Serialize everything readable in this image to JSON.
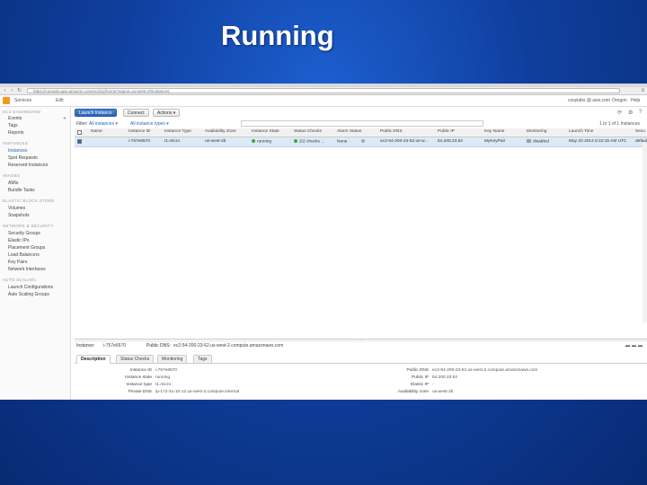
{
  "slide": {
    "title": "Running"
  },
  "browser": {
    "back_icon": "back-arrow-icon",
    "forward_icon": "forward-arrow-icon",
    "reload_icon": "reload-icon",
    "url": "https://console.aws.amazon.com/ec2/v2/home?region=us-west-2#Instances:",
    "menu_icon": "menu-icon"
  },
  "aws_nav": {
    "services": "Services",
    "edit": "Edit",
    "account": "cosylabs @ aws.com",
    "region": "Oregon",
    "help": "Help"
  },
  "sidebar": {
    "sections": [
      {
        "label": "EC2 DASHBOARD"
      },
      {
        "label": "INSTANCES"
      },
      {
        "label": "IMAGES"
      },
      {
        "label": "ELASTIC BLOCK STORE"
      },
      {
        "label": "NETWORK & SECURITY"
      },
      {
        "label": "AUTO SCALING"
      }
    ],
    "items": [
      {
        "label": "Events"
      },
      {
        "label": "Tags"
      },
      {
        "label": "Reports"
      },
      {
        "label": "Instances"
      },
      {
        "label": "Spot Requests"
      },
      {
        "label": "Reserved Instances"
      },
      {
        "label": "AMIs"
      },
      {
        "label": "Bundle Tasks"
      },
      {
        "label": "Volumes"
      },
      {
        "label": "Snapshots"
      },
      {
        "label": "Security Groups"
      },
      {
        "label": "Elastic IPs"
      },
      {
        "label": "Placement Groups"
      },
      {
        "label": "Load Balancers"
      },
      {
        "label": "Key Pairs"
      },
      {
        "label": "Network Interfaces"
      },
      {
        "label": "Launch Configurations"
      },
      {
        "label": "Auto Scaling Groups"
      }
    ]
  },
  "toolbar": {
    "launch": "Launch Instance",
    "connect": "Connect",
    "actions": "Actions ▾",
    "refresh_icon": "refresh-icon",
    "settings_icon": "gear-icon",
    "help_icon": "help-icon"
  },
  "filter": {
    "label": "Filter:",
    "instances": "All instances ▾",
    "types": "All instance types ▾",
    "pager": "1 to 1 of 1 Instances"
  },
  "table": {
    "headers": [
      "Name",
      "Instance ID",
      "Instance Type",
      "Availability Zone",
      "Instance State",
      "Status Checks",
      "Alarm Status",
      "Public DNS",
      "Public IP",
      "Key Name",
      "Monitoring",
      "Launch Time",
      "Secu"
    ],
    "row": {
      "name": "",
      "instance_id": "i-757e6570",
      "type": "t1.micro",
      "zone": "us-west-2b",
      "state": "running",
      "checks": "2/2 checks ...",
      "alarm": "None",
      "dns": "ec2-54-200-23-62.us-w...",
      "ip": "54.200.23.62",
      "key": "MyKeyPair",
      "monitoring": "disabled",
      "launch": "May 20 2014 5:10:15 AM UTC",
      "security": "default"
    }
  },
  "detail": {
    "instance_label": "Instance:",
    "instance_id": "i-757e6570",
    "dns_label": "Public DNS:",
    "dns_value": "ec2-54-200-23-62.us-west-2.compute.amazonaws.com",
    "tabs": [
      "Description",
      "Status Checks",
      "Monitoring",
      "Tags"
    ],
    "left": [
      {
        "label": "Instance ID",
        "value": "i-757e6570"
      },
      {
        "label": "Instance state",
        "value": "running"
      },
      {
        "label": "Instance type",
        "value": "t1.micro"
      },
      {
        "label": "Private DNS",
        "value": "ip-172-31-10-12.us-west-2.compute.internal"
      }
    ],
    "right": [
      {
        "label": "Public DNS",
        "value": "ec2-54-200-23-62.us-west-2.compute.amazonaws.com"
      },
      {
        "label": "Public IP",
        "value": "54.200.23.62"
      },
      {
        "label": "Elastic IP",
        "value": "-"
      },
      {
        "label": "Availability zone",
        "value": "us-west-2b"
      }
    ]
  },
  "colors": {
    "aws_orange": "#f29a1e",
    "primary_button": "#2c60b0",
    "selected_row": "#dce9f7",
    "running_green": "#3da73d"
  }
}
